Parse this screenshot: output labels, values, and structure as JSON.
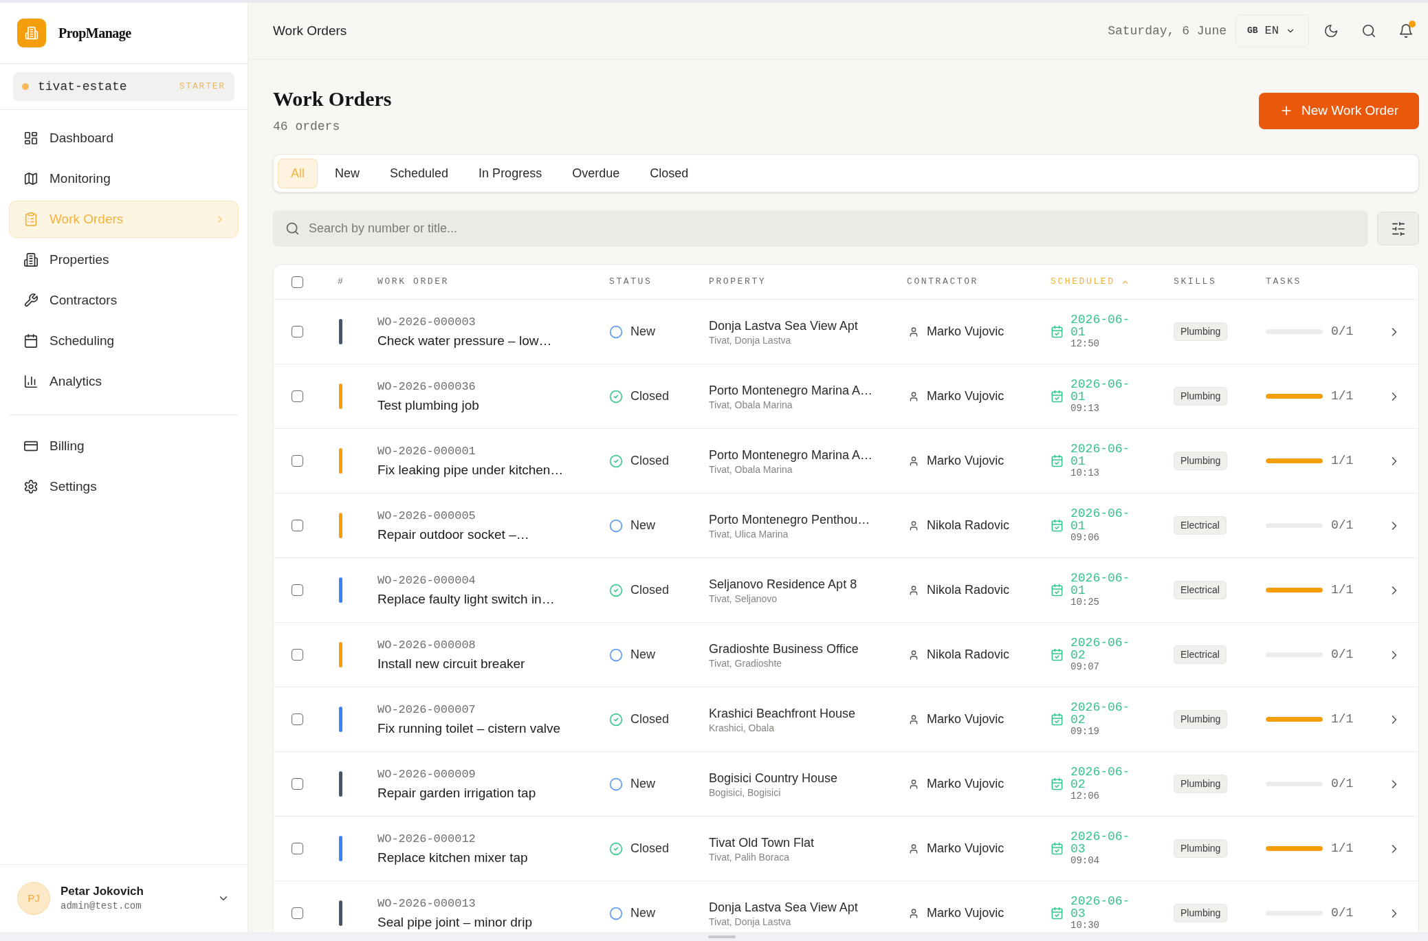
{
  "sidebar": {
    "brand": "PropManage",
    "workspace": {
      "name": "tivat-estate",
      "plan": "STARTER"
    },
    "nav": [
      {
        "label": "Dashboard",
        "selected": false
      },
      {
        "label": "Monitoring",
        "selected": false
      },
      {
        "label": "Work Orders",
        "selected": true
      },
      {
        "label": "Properties",
        "selected": false
      },
      {
        "label": "Contractors",
        "selected": false
      },
      {
        "label": "Scheduling",
        "selected": false
      },
      {
        "label": "Analytics",
        "selected": false
      }
    ],
    "nav_secondary": [
      {
        "label": "Billing",
        "selected": false
      },
      {
        "label": "Settings",
        "selected": false
      }
    ],
    "user": {
      "initials": "PJ",
      "name": "Petar Jokovich",
      "email": "admin@test.com"
    }
  },
  "header": {
    "title": "Work Orders",
    "date": "Saturday, 6 June",
    "language": {
      "region": "GB",
      "code": "EN"
    },
    "notification": true
  },
  "page": {
    "title": "Work Orders",
    "count": "46 orders",
    "new_button": "New Work Order"
  },
  "tabs": [
    {
      "label": "All",
      "selected": true
    },
    {
      "label": "New",
      "selected": false
    },
    {
      "label": "Scheduled",
      "selected": false
    },
    {
      "label": "In Progress",
      "selected": false
    },
    {
      "label": "Overdue",
      "selected": false
    },
    {
      "label": "Closed",
      "selected": false
    }
  ],
  "search": {
    "placeholder": "Search by number or title..."
  },
  "table": {
    "select_all_checked": false,
    "columns": [
      {
        "label": "#",
        "sorted": false
      },
      {
        "label": "WORK ORDER",
        "sorted": false
      },
      {
        "label": "STATUS",
        "sorted": false
      },
      {
        "label": "PROPERTY",
        "sorted": false
      },
      {
        "label": "CONTRACTOR",
        "sorted": false
      },
      {
        "label": "SCHEDULED",
        "sorted": true
      },
      {
        "label": "SKILLS",
        "sorted": false
      },
      {
        "label": "TASKS",
        "sorted": false
      }
    ],
    "rows": [
      {
        "checked": false,
        "color": "#475569",
        "number": "WO-2026-000003",
        "title": "Check water pressure – low…",
        "status": {
          "label": "New",
          "kind": "new"
        },
        "property": "Donja Lastva Sea View Apt",
        "location": "Tivat, Donja Lastva",
        "contractor": "Marko Vujovic",
        "date": "2026-06-01",
        "time": "12:50",
        "skill": "Plumbing",
        "level": 0,
        "tasks": "0/1"
      },
      {
        "checked": false,
        "color": "#f59e0b",
        "number": "WO-2026-000036",
        "title": "Test plumbing job",
        "status": {
          "label": "Closed",
          "kind": "closed"
        },
        "property": "Porto Montenegro Marina A…",
        "location": "Tivat, Obala Marina",
        "contractor": "Marko Vujovic",
        "date": "2026-06-01",
        "time": "09:13",
        "skill": "Plumbing",
        "level": 1,
        "tasks": "1/1"
      },
      {
        "checked": false,
        "color": "#f59e0b",
        "number": "WO-2026-000001",
        "title": "Fix leaking pipe under kitchen…",
        "status": {
          "label": "Closed",
          "kind": "closed"
        },
        "property": "Porto Montenegro Marina A…",
        "location": "Tivat, Obala Marina",
        "contractor": "Marko Vujovic",
        "date": "2026-06-01",
        "time": "10:13",
        "skill": "Plumbing",
        "level": 1,
        "tasks": "1/1"
      },
      {
        "checked": false,
        "color": "#f59e0b",
        "number": "WO-2026-000005",
        "title": "Repair outdoor socket –…",
        "status": {
          "label": "New",
          "kind": "new"
        },
        "property": "Porto Montenegro Penthou…",
        "location": "Tivat, Ulica Marina",
        "contractor": "Nikola Radovic",
        "date": "2026-06-01",
        "time": "09:06",
        "skill": "Electrical",
        "level": 0,
        "tasks": "0/1"
      },
      {
        "checked": false,
        "color": "#3b82f6",
        "number": "WO-2026-000004",
        "title": "Replace faulty light switch in…",
        "status": {
          "label": "Closed",
          "kind": "closed"
        },
        "property": "Seljanovo Residence Apt 8",
        "location": "Tivat, Seljanovo",
        "contractor": "Nikola Radovic",
        "date": "2026-06-01",
        "time": "10:25",
        "skill": "Electrical",
        "level": 1,
        "tasks": "1/1"
      },
      {
        "checked": false,
        "color": "#f59e0b",
        "number": "WO-2026-000008",
        "title": "Install new circuit breaker",
        "status": {
          "label": "New",
          "kind": "new"
        },
        "property": "Gradioshte Business Office",
        "location": "Tivat, Gradioshte",
        "contractor": "Nikola Radovic",
        "date": "2026-06-02",
        "time": "09:07",
        "skill": "Electrical",
        "level": 0,
        "tasks": "0/1"
      },
      {
        "checked": false,
        "color": "#3b82f6",
        "number": "WO-2026-000007",
        "title": "Fix running toilet – cistern valve",
        "status": {
          "label": "Closed",
          "kind": "closed"
        },
        "property": "Krashici Beachfront House",
        "location": "Krashici, Obala",
        "contractor": "Marko Vujovic",
        "date": "2026-06-02",
        "time": "09:19",
        "skill": "Plumbing",
        "level": 1,
        "tasks": "1/1"
      },
      {
        "checked": false,
        "color": "#475569",
        "number": "WO-2026-000009",
        "title": "Repair garden irrigation tap",
        "status": {
          "label": "New",
          "kind": "new"
        },
        "property": "Bogisici Country House",
        "location": "Bogisici, Bogisici",
        "contractor": "Marko Vujovic",
        "date": "2026-06-02",
        "time": "12:06",
        "skill": "Plumbing",
        "level": 0,
        "tasks": "0/1"
      },
      {
        "checked": false,
        "color": "#3b82f6",
        "number": "WO-2026-000012",
        "title": "Replace kitchen mixer tap",
        "status": {
          "label": "Closed",
          "kind": "closed"
        },
        "property": "Tivat Old Town Flat",
        "location": "Tivat, Palih Boraca",
        "contractor": "Marko Vujovic",
        "date": "2026-06-03",
        "time": "09:04",
        "skill": "Plumbing",
        "level": 1,
        "tasks": "1/1"
      },
      {
        "checked": false,
        "color": "#475569",
        "number": "WO-2026-000013",
        "title": "Seal pipe joint – minor drip",
        "status": {
          "label": "New",
          "kind": "new"
        },
        "property": "Donja Lastva Sea View Apt",
        "location": "Tivat, Donja Lastva",
        "contractor": "Marko Vujovic",
        "date": "2026-06-03",
        "time": "10:30",
        "skill": "Plumbing",
        "level": 0,
        "tasks": "0/1"
      }
    ]
  }
}
